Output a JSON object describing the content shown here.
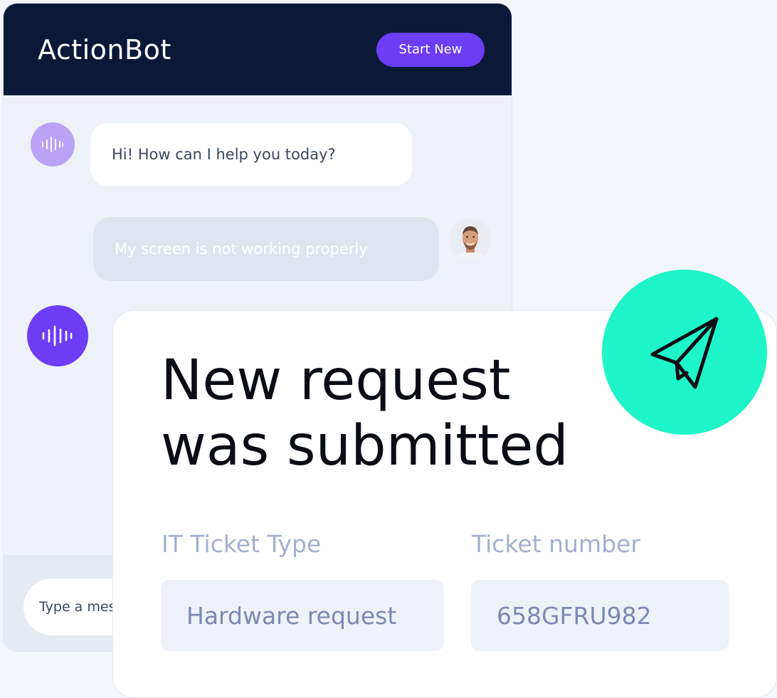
{
  "app": {
    "title": "ActionBot",
    "start_new_label": "Start New"
  },
  "conversation": {
    "bot_message": "Hi! How can I help you today?",
    "user_message": "My screen is not working properly"
  },
  "composer": {
    "placeholder": "Type a message"
  },
  "request": {
    "title_line1": "New request",
    "title_line2": "was submitted",
    "ticket_type_label": "IT Ticket Type",
    "ticket_type_value": "Hardware request",
    "ticket_number_label": "Ticket number",
    "ticket_number_value": "658GFRU982"
  },
  "icons": {
    "bot": "sound-wave-icon",
    "user": "user-avatar",
    "send": "paper-plane-icon"
  },
  "colors": {
    "header_bg": "#0b1838",
    "accent_purple": "#6c3df5",
    "accent_mint": "#1ef5c9"
  }
}
